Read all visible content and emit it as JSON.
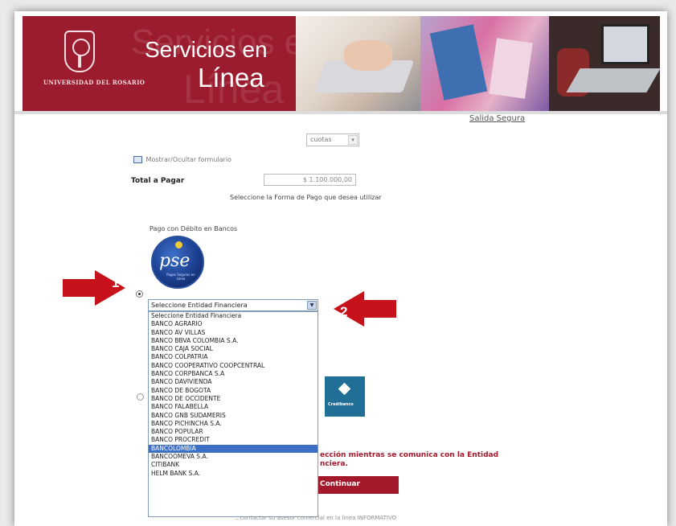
{
  "banner": {
    "university": "UNIVERSIDAD DEL ROSARIO",
    "title_line1": "Servicios en",
    "title_line2": "Línea"
  },
  "header": {
    "secure_exit_link": "Salida Segura"
  },
  "installments": {
    "selected": "cuotas"
  },
  "form": {
    "toggle_form_label": "Mostrar/Ocultar formulario",
    "total_label": "Total a Pagar",
    "total_value": "$ 1.100.000,00",
    "payment_method_prompt": "Seleccione la Forma de Pago que desea utilizar"
  },
  "payment_pse": {
    "label": "Pago con Débito en Bancos",
    "logo_text": "pse",
    "logo_subtext": "Pagos Seguros en Línea",
    "select_value": "Seleccione Entidad Financiera",
    "options": [
      "Seleccione Entidad Financiera",
      "BANCO AGRARIO",
      "BANCO AV VILLAS",
      "BANCO BBVA COLOMBIA S.A.",
      "BANCO CAJA SOCIAL",
      "BANCO COLPATRIA",
      "BANCO COOPERATIVO COOPCENTRAL",
      "BANCO CORPBANCA S.A",
      "BANCO DAVIVIENDA",
      "BANCO DE BOGOTA",
      "BANCO DE OCCIDENTE",
      "BANCO FALABELLA",
      "BANCO GNB SUDAMERIS",
      "BANCO PICHINCHA S.A.",
      "BANCO POPULAR",
      "BANCO PROCREDIT",
      "BANCOLOMBIA",
      "BANCOOMEVA S.A.",
      "CITIBANK",
      "HELM BANK S.A."
    ],
    "highlighted_option": "BANCOLOMBIA"
  },
  "payment_other": {
    "logo_text": "Credibanco"
  },
  "warning": {
    "line1": "ección mientras se comunica con la Entidad",
    "line2": "nciera."
  },
  "continue_button": "Continuar",
  "footer_note": "...contactar su asesor comercial en la línea INFORMATIVO",
  "annotations": {
    "arrow1": "1",
    "arrow2": "2",
    "arrow_color": "#c8121b"
  },
  "colors": {
    "brand": "#9b1c2e",
    "accent": "#a3182a",
    "selection": "#3d6fc5"
  }
}
